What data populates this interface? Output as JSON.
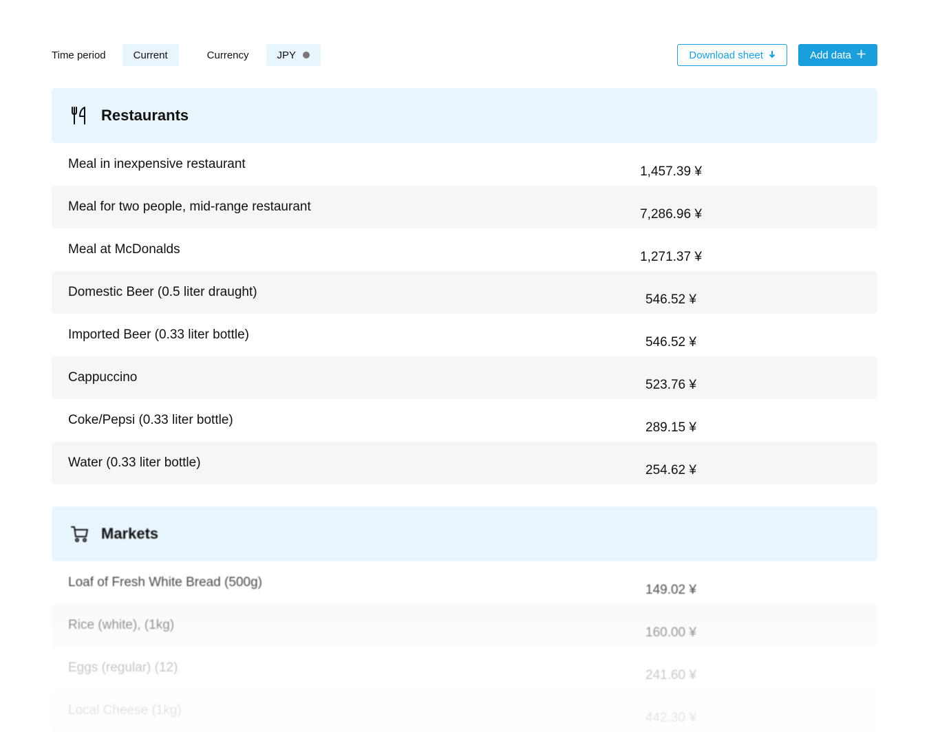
{
  "filters": {
    "time_period_label": "Time period",
    "time_period_value": "Current",
    "currency_label": "Currency",
    "currency_value": "JPY"
  },
  "actions": {
    "download_label": "Download sheet",
    "add_label": "Add data"
  },
  "colors": {
    "accent": "#1b9fdc",
    "section_bg": "#e8f5fc",
    "row_alt_bg": "#f6f6f6"
  },
  "restaurants": {
    "title": "Restaurants",
    "icon": "fork-knife-icon",
    "items": [
      {
        "name": "Meal in inexpensive restaurant",
        "price": "1,457.39 ¥"
      },
      {
        "name": "Meal for two people, mid-range restaurant",
        "price": "7,286.96 ¥"
      },
      {
        "name": "Meal at McDonalds",
        "price": "1,271.37 ¥"
      },
      {
        "name": "Domestic Beer (0.5 liter draught)",
        "price": "546.52 ¥"
      },
      {
        "name": "Imported Beer (0.33 liter bottle)",
        "price": "546.52 ¥"
      },
      {
        "name": "Cappuccino",
        "price": "523.76 ¥"
      },
      {
        "name": "Coke/Pepsi (0.33 liter bottle)",
        "price": "289.15 ¥"
      },
      {
        "name": "Water (0.33 liter bottle)",
        "price": "254.62 ¥"
      }
    ]
  },
  "markets": {
    "title": "Markets",
    "icon": "shopping-cart-icon",
    "items": [
      {
        "name": "Loaf of Fresh White Bread (500g)",
        "price": "149.02 ¥"
      },
      {
        "name": "Rice (white), (1kg)",
        "price": "160.00 ¥"
      },
      {
        "name": "Eggs (regular) (12)",
        "price": "241.60 ¥"
      },
      {
        "name": "Local Cheese (1kg)",
        "price": "442.30 ¥"
      }
    ]
  }
}
